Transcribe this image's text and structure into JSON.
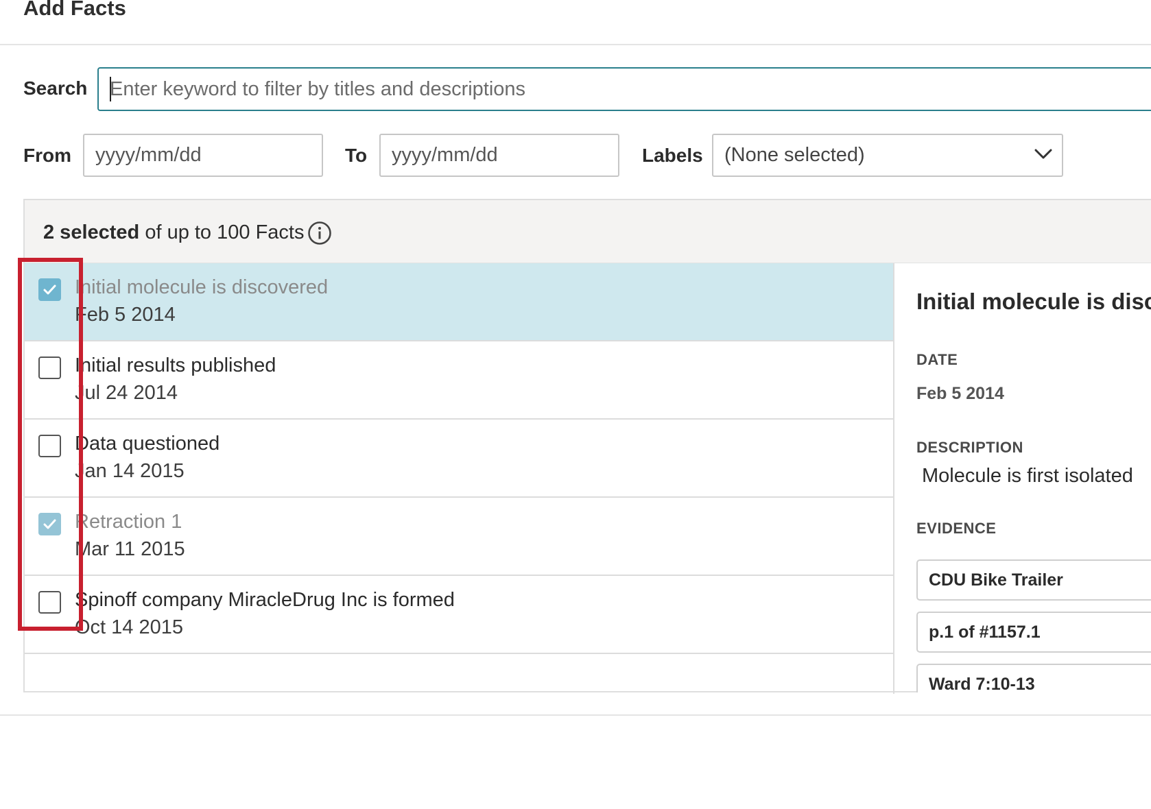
{
  "title": "Add Facts",
  "search": {
    "label": "Search",
    "placeholder": "Enter keyword to filter by titles and descriptions"
  },
  "filters": {
    "from_label": "From",
    "from_placeholder": "yyyy/mm/dd",
    "to_label": "To",
    "to_placeholder": "yyyy/mm/dd",
    "labels_label": "Labels",
    "labels_value": "(None selected)"
  },
  "summary": {
    "selected": "2 selected",
    "rest": " of up to 100 Facts"
  },
  "facts": [
    {
      "title": "Initial molecule is discovered",
      "date": "Feb 5 2014",
      "checked": true,
      "active": true
    },
    {
      "title": "Initial results published",
      "date": "Jul 24 2014",
      "checked": false,
      "active": false
    },
    {
      "title": "Data questioned",
      "date": "Jan 14 2015",
      "checked": false,
      "active": false
    },
    {
      "title": "Retraction 1",
      "date": "Mar 11 2015",
      "checked": true,
      "active": false
    },
    {
      "title": "Spinoff company MiracleDrug Inc is formed",
      "date": "Oct 14 2015",
      "checked": false,
      "active": false
    }
  ],
  "detail": {
    "title": "Initial molecule is disco",
    "date_caption": "DATE",
    "date": "Feb 5 2014",
    "description_caption": "DESCRIPTION",
    "description": "Molecule is first isolated",
    "evidence_caption": "EVIDENCE",
    "evidence": [
      "CDU Bike Trailer",
      "p.1 of #1157.1",
      "Ward 7:10-13"
    ]
  },
  "colors": {
    "accent": "#2a7f8c",
    "active_row": "#cfe8ee",
    "checkbox_checked": "#6fb5cf",
    "highlight_box": "#c8202f"
  }
}
